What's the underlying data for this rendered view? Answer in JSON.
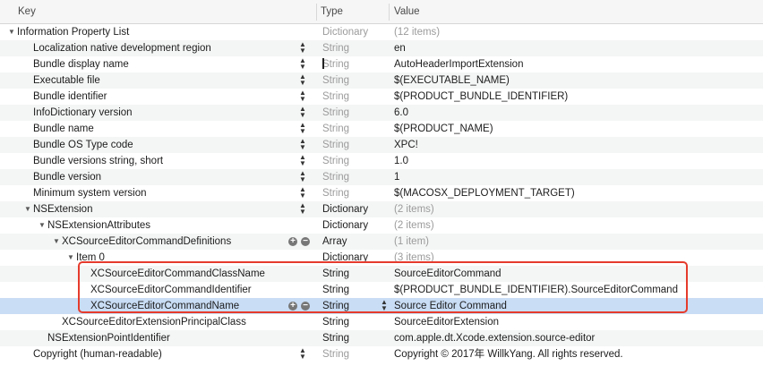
{
  "header": {
    "key": "Key",
    "type": "Type",
    "value": "Value"
  },
  "rows": [
    {
      "key": "Information Property List",
      "type": "Dictionary",
      "value": "(12 items)"
    },
    {
      "key": "Localization native development region",
      "type": "String",
      "value": "en"
    },
    {
      "key": "Bundle display name",
      "type": "String",
      "value": "AutoHeaderImportExtension"
    },
    {
      "key": "Executable file",
      "type": "String",
      "value": "$(EXECUTABLE_NAME)"
    },
    {
      "key": "Bundle identifier",
      "type": "String",
      "value": "$(PRODUCT_BUNDLE_IDENTIFIER)"
    },
    {
      "key": "InfoDictionary version",
      "type": "String",
      "value": "6.0"
    },
    {
      "key": "Bundle name",
      "type": "String",
      "value": "$(PRODUCT_NAME)"
    },
    {
      "key": "Bundle OS Type code",
      "type": "String",
      "value": "XPC!"
    },
    {
      "key": "Bundle versions string, short",
      "type": "String",
      "value": "1.0"
    },
    {
      "key": "Bundle version",
      "type": "String",
      "value": "1"
    },
    {
      "key": "Minimum system version",
      "type": "String",
      "value": "$(MACOSX_DEPLOYMENT_TARGET)"
    },
    {
      "key": "NSExtension",
      "type": "Dictionary",
      "value": "(2 items)"
    },
    {
      "key": "NSExtensionAttributes",
      "type": "Dictionary",
      "value": "(2 items)"
    },
    {
      "key": "XCSourceEditorCommandDefinitions",
      "type": "Array",
      "value": "(1 item)"
    },
    {
      "key": "Item 0",
      "type": "Dictionary",
      "value": "(3 items)"
    },
    {
      "key": "XCSourceEditorCommandClassName",
      "type": "String",
      "value": "SourceEditorCommand"
    },
    {
      "key": "XCSourceEditorCommandIdentifier",
      "type": "String",
      "value": "$(PRODUCT_BUNDLE_IDENTIFIER).SourceEditorCommand"
    },
    {
      "key": "XCSourceEditorCommandName",
      "type": "String",
      "value": "Source Editor Command"
    },
    {
      "key": "XCSourceEditorExtensionPrincipalClass",
      "type": "String",
      "value": "SourceEditorExtension"
    },
    {
      "key": "NSExtensionPointIdentifier",
      "type": "String",
      "value": "com.apple.dt.Xcode.extension.source-editor"
    },
    {
      "key": "Copyright (human-readable)",
      "type": "String",
      "value": "Copyright © 2017年 WillkYang. All rights reserved."
    }
  ],
  "colors": {
    "selected_row": "#c9ddf5",
    "highlight_box": "#e53b2c",
    "grey_text": "#9b9b9b"
  }
}
